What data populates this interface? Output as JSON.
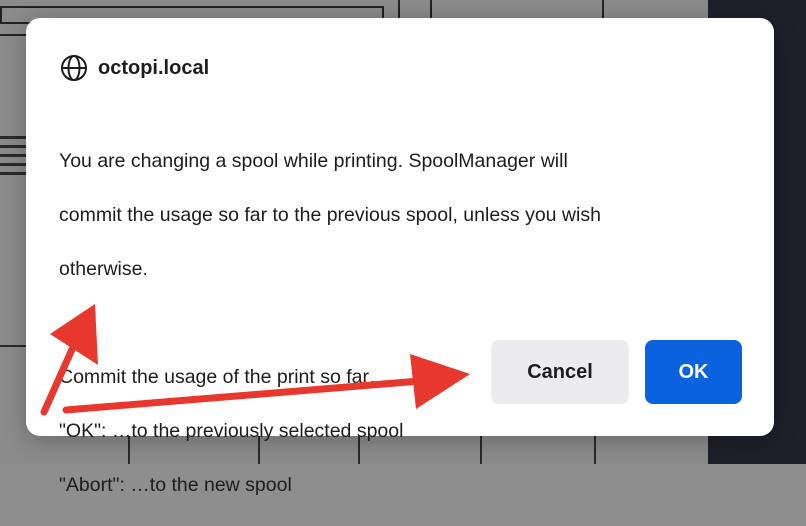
{
  "dialog": {
    "origin": "octopi.local",
    "message_lines": [
      "You are changing a spool while printing. SpoolManager will",
      "commit the usage so far to the previous spool, unless you wish",
      "otherwise."
    ],
    "commit_lines": [
      "Commit the usage of the print so far…",
      "\"OK\": …to the previously selected spool",
      "\"Abort\": …to the new spool"
    ],
    "cancel_label": "Cancel",
    "ok_label": "OK",
    "ok_color": "#0b62df"
  },
  "annotations": {
    "arrow_color": "#e8382e",
    "arrows": [
      "arrow-to-abort-line",
      "arrow-to-cancel-button"
    ]
  }
}
